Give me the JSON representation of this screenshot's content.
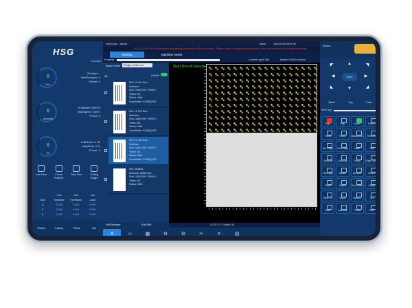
{
  "left_panel": {
    "logo": "HSG",
    "operator": "Operator",
    "gauges": [
      {
        "value": "0",
        "unit": "bar",
        "info": [
          "GasType: -",
          "MaxPressure: 0",
          "Preset: 0"
        ]
      },
      {
        "value": "0",
        "unit": "mm/min",
        "info": [
          "CutSpeed: 6262%",
          "MaxSpeed: 19/0/1",
          "Preset: 0"
        ]
      },
      {
        "value": "0",
        "unit": "W",
        "info": [
          "CutPeriod: 0 Hz",
          "DutyRatio: 0 %",
          "Preset: 0"
        ]
      }
    ],
    "buttons": [
      {
        "label": "Low Heat"
      },
      {
        "label": "Focus Position"
      },
      {
        "label": "Spot Size"
      },
      {
        "label": "Cutting Height"
      }
    ],
    "axis_units": [
      "",
      "mm",
      "mm",
      "mm"
    ],
    "axis_header": [
      "Axis",
      "Machine",
      "Feedback",
      "Load"
    ],
    "axis_rows": [
      {
        "axis": "X",
        "machine": "0.000",
        "feedback": "0.000",
        "load": "0.000"
      },
      {
        "axis": "Y",
        "machine": "0.000",
        "feedback": "0.000",
        "load": "0.000"
      },
      {
        "axis": "Z",
        "machine": "0.000",
        "feedback": "0.000",
        "load": "0.000"
      }
    ],
    "bottom": [
      "Station",
      "Cutting",
      "Follow",
      "Bla"
    ]
  },
  "topbar": {
    "title": "HSGCoute - Alpha1",
    "batch": "Batch:",
    "date": "2022/11/25 08:57:59",
    "alarm": "2022-11-25 09:20:49  Workstation Remaining Maintenance Time Reached... Please clean or change the spare parts of the dust removal unit to prevent damage"
  },
  "tabs": [
    "Nesting",
    "Machine Assist"
  ],
  "progress": {
    "label": "Progress",
    "current_layer": "Current Layer: N/A",
    "speed": "Speed: 0.0000 mm/min"
  },
  "file_list": {
    "batch_mode": "Batch Mode",
    "batch_value": "Single mode cut",
    "all": "All",
    "unfold": "Unfold",
    "items": [
      {
        "lines": [
          "File: 10 101 Nes...",
          "Sections: ",
          "Size: 1462.2X6 * 2905.0",
          "Times: 0/1",
          "Status: Wait",
          "Coordinate: CCW(0),000"
        ]
      },
      {
        "lines": [
          "File: 10 102 Nes...",
          "Sections: ",
          "Size: 1462.2X6 * 2905.0",
          "Times: 0/1",
          "Status: Wait",
          "Coordinate: CCW(0),000"
        ]
      },
      {
        "lines": [
          "File: 10 103 Nes...",
          "Sections: ",
          "Size: 1462.2X6 * 2905.0",
          "Times: 0/1",
          "Status: Wait",
          "Coordinate: CCW(0),000"
        ]
      },
      {
        "lines": [
          "File: Untitled...",
          "Sections: 6488 Cuts...",
          "Size: 1400.0X0 * 2904.0",
          "Times: 0/1",
          "Status: Wait"
        ]
      }
    ],
    "edit_section": "Edit Section",
    "edit_file": "Edit File"
  },
  "canvas": {
    "label": "Nest Result Result",
    "info": "0.2   X: 0   Y: 0   Move On"
  },
  "right_panel": {
    "nodes": "Nodes",
    "center": "Slow",
    "modes": [
      "Swell",
      "Jog",
      "Fast"
    ],
    "speed_label": "SEM Jog",
    "grid": [
      {
        "label": "Start",
        "color": "red"
      },
      {
        "label": "Stop",
        "color": ""
      },
      {
        "label": "Locate",
        "color": "grn"
      },
      {
        "label": "Return",
        "color": ""
      },
      {
        "label": "Frame",
        "color": ""
      },
      {
        "label": "Pause",
        "color": ""
      },
      {
        "label": "Breakpoint",
        "color": ""
      },
      {
        "label": "Resume",
        "color": ""
      },
      {
        "label": "Set Origin",
        "color": ""
      },
      {
        "label": "Find Edge",
        "color": ""
      },
      {
        "label": "Laser",
        "color": ""
      },
      {
        "label": "Gas",
        "color": ""
      },
      {
        "label": "Calibrate",
        "color": ""
      },
      {
        "label": "Cleaning",
        "color": ""
      },
      {
        "label": "Follow",
        "color": ""
      },
      {
        "label": "Edge Seek",
        "color": ""
      },
      {
        "label": "Red Light",
        "color": ""
      },
      {
        "label": "Shutter",
        "color": ""
      },
      {
        "label": "Air Blow",
        "color": ""
      },
      {
        "label": "Nozzle",
        "color": ""
      },
      {
        "label": "Preset",
        "color": ""
      },
      {
        "label": "Station",
        "color": ""
      },
      {
        "label": "Pre-Stroke",
        "color": ""
      },
      {
        "label": "Clamp",
        "color": ""
      },
      {
        "label": "Blow On",
        "color": ""
      },
      {
        "label": "Adjust",
        "color": ""
      },
      {
        "label": "Manual",
        "color": ""
      },
      {
        "label": "Cut",
        "color": ""
      },
      {
        "label": "Drain",
        "color": ""
      },
      {
        "label": "Lubricate",
        "color": ""
      },
      {
        "label": "Follow",
        "color": ""
      },
      {
        "label": "Zero",
        "color": ""
      }
    ]
  },
  "bottom_bar": [
    "✕",
    "▱",
    "▦",
    "⚙",
    "⚙",
    "✂",
    "✕",
    "▤"
  ]
}
